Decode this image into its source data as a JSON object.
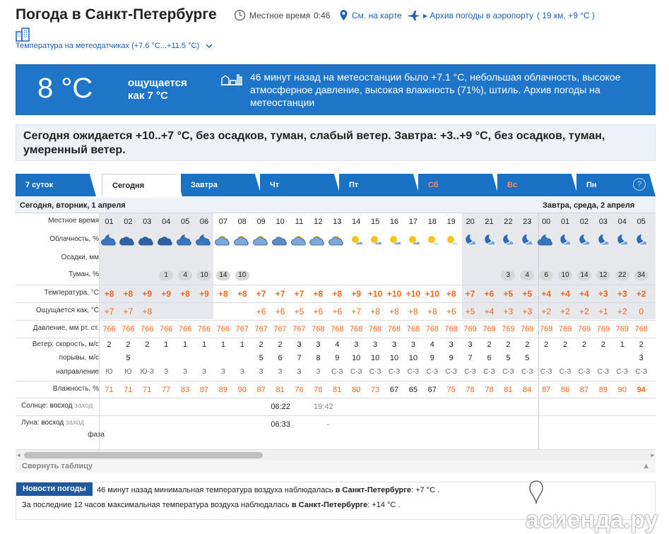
{
  "header": {
    "title": "Погода в Санкт-Петербурге",
    "local_time_label": "Местное время",
    "local_time": "0:46",
    "map_link": "См. на карте",
    "airport_link": "Архив погоды в аэропорту",
    "airport_info": "( 19 км, +9 °C )",
    "sensors_link": "Температура на метеодатчиках (+7.6 °C...+11.5 °C)"
  },
  "now": {
    "temp": "8 °C",
    "feels_line1": "ощущается",
    "feels_line2": "как 7 °C",
    "description": "46 минут назад на метеостанции было +7.1 °C, небольшая облачность, высокое атмосферное давление, высокая влажность (71%), штиль. Архив погоды на метеостанции"
  },
  "forecast_text": "Сегодня ожидается +10..+7 °C, без осадков, туман, слабый ветер. Завтра: +3..+9 °C, без осадков, туман, умеренный ветер.",
  "tabs": [
    {
      "label": "7 суток",
      "active": false,
      "weekend": false
    },
    {
      "label": "Сегодня",
      "active": true,
      "weekend": false
    },
    {
      "label": "Завтра",
      "active": false,
      "weekend": false
    },
    {
      "label": "Чт",
      "active": false,
      "weekend": false
    },
    {
      "label": "Пт",
      "active": false,
      "weekend": false
    },
    {
      "label": "Сб",
      "active": false,
      "weekend": true
    },
    {
      "label": "Вс",
      "active": false,
      "weekend": true
    },
    {
      "label": "Пн",
      "active": false,
      "weekend": false
    }
  ],
  "help": "?",
  "day1_label": "Сегодня, вторник, 1 апреля",
  "day2_label": "Завтра, среда, 2 апреля",
  "rows": {
    "time": "Местное время",
    "clouds": "Облачность, %",
    "precip": "Осадки, мм",
    "fog": "Туман, %",
    "temp": "Температура, °C",
    "feels": "Ощущается как, °C",
    "pressure": "Давление, мм рт. ст.",
    "wind_speed": "Ветер: скорость, м/с",
    "gusts": "порывы, м/с",
    "direction": "направление",
    "humidity": "Влажность, %",
    "sun_prefix": "Солнце:",
    "sun_rise": "восход",
    "sun_set": "заход",
    "moon_prefix": "Луна:",
    "moon_rise": "восход",
    "moon_set": "заход",
    "moon_phase": "фаза"
  },
  "hours": [
    "01",
    "02",
    "03",
    "04",
    "05",
    "06",
    "07",
    "08",
    "09",
    "10",
    "11",
    "12",
    "13",
    "14",
    "15",
    "16",
    "17",
    "18",
    "19",
    "20",
    "21",
    "22",
    "23",
    "00",
    "01",
    "02",
    "03",
    "04",
    "05"
  ],
  "cloud_icons": [
    "cloud-night",
    "cloud-dark",
    "cloud-dark",
    "cloud-dark",
    "cloud-night",
    "cloud-night",
    "sun-cloud",
    "sun-cloud",
    "sun-cloud",
    "cloud",
    "sun-cloud",
    "sun-cloud",
    "sun-cloud",
    "sun-small-cloud",
    "sun-small-cloud",
    "sun-small-cloud",
    "sun-small-cloud",
    "sun",
    "sun",
    "moon-cloud",
    "moon-cloud",
    "moon-cloud",
    "moon-cloud",
    "cloud-night",
    "moon-cloud",
    "moon-cloud",
    "moon-cloud",
    "moon-cloud",
    "moon-cloud"
  ],
  "fog": [
    "",
    "",
    "",
    "1",
    "4",
    "10",
    "14",
    "10",
    "",
    "",
    "",
    "",
    "",
    "",
    "",
    "",
    "",
    "",
    "",
    "",
    "",
    "3",
    "4",
    "6",
    "10",
    "14",
    "12",
    "22",
    "34"
  ],
  "temp": [
    "+8",
    "+8",
    "+9",
    "+9",
    "+8",
    "+9",
    "+8",
    "+8",
    "+7",
    "+7",
    "+7",
    "+8",
    "+8",
    "+9",
    "+10",
    "+10",
    "+10",
    "+10",
    "+8",
    "+7",
    "+6",
    "+5",
    "+5",
    "+4",
    "+4",
    "+4",
    "+3",
    "+3",
    "+2"
  ],
  "feels": [
    "+7",
    "+7",
    "+8",
    "",
    "",
    "",
    "",
    "",
    "+6",
    "+6",
    "+5",
    "+6",
    "+6",
    "+7",
    "+8",
    "+8",
    "+8",
    "+8",
    "+6",
    "+5",
    "+4",
    "+3",
    "+3",
    "+2",
    "+2",
    "+2",
    "+1",
    "+2",
    "0"
  ],
  "pressure": [
    "766",
    "766",
    "766",
    "766",
    "766",
    "766",
    "766",
    "767",
    "767",
    "767",
    "767",
    "768",
    "768",
    "768",
    "768",
    "768",
    "768",
    "768",
    "768",
    "769",
    "769",
    "769",
    "769",
    "769",
    "769",
    "769",
    "769",
    "769",
    "768"
  ],
  "wind": [
    "2",
    "2",
    "2",
    "1",
    "1",
    "1",
    "1",
    "1",
    "2",
    "2",
    "3",
    "3",
    "4",
    "3",
    "3",
    "3",
    "3",
    "4",
    "3",
    "3",
    "2",
    "2",
    "2",
    "2",
    "2",
    "2",
    "2",
    "1",
    "2"
  ],
  "gusts": [
    "",
    "5",
    "",
    "",
    "",
    "",
    "",
    "",
    "5",
    "6",
    "7",
    "8",
    "9",
    "10",
    "10",
    "10",
    "10",
    "9",
    "9",
    "7",
    "6",
    "5",
    "5",
    "",
    "",
    "",
    "",
    "",
    "3"
  ],
  "direction": [
    "Ю",
    "Ю",
    "Ю-З",
    "З",
    "З",
    "З",
    "З",
    "З",
    "З",
    "З",
    "З",
    "З",
    "С-З",
    "С-З",
    "С-З",
    "С-З",
    "С-З",
    "С-З",
    "С-З",
    "С-З",
    "С-З",
    "С-З",
    "С-З",
    "С-З",
    "С-З",
    "С-З",
    "С-З",
    "С-З",
    "С-З"
  ],
  "humidity": [
    "71",
    "71",
    "71",
    "77",
    "83",
    "87",
    "89",
    "90",
    "87",
    "81",
    "76",
    "78",
    "81",
    "80",
    "73",
    "67",
    "65",
    "67",
    "75",
    "78",
    "78",
    "81",
    "84",
    "87",
    "86",
    "87",
    "89",
    "90",
    "94"
  ],
  "humidity_black": [
    15,
    16,
    17
  ],
  "sun_rise_time": "06:22",
  "sun_set_time": "19:42",
  "moon_rise_time": "06:33",
  "moon_set_time": "-",
  "collapse_label": "Свернуть таблицу",
  "news": {
    "badge": "Новости погоды",
    "line1_pre": "46 минут назад минимальная температура воздуха наблюдалась",
    "line1_city": "в Санкт-Петербурге",
    "line1_post": ": +7 °C .",
    "line2_pre": "За последние 12 часов максимальная температура воздуха наблюдалась",
    "line2_city": "в Санкт-Петербурге",
    "line2_post": ": +14 °C ."
  },
  "watermark": "асиенда.ру",
  "colors": {
    "accent": "#1b72c4",
    "orange": "#f2661f",
    "night_shade": "#e6e8eb"
  }
}
